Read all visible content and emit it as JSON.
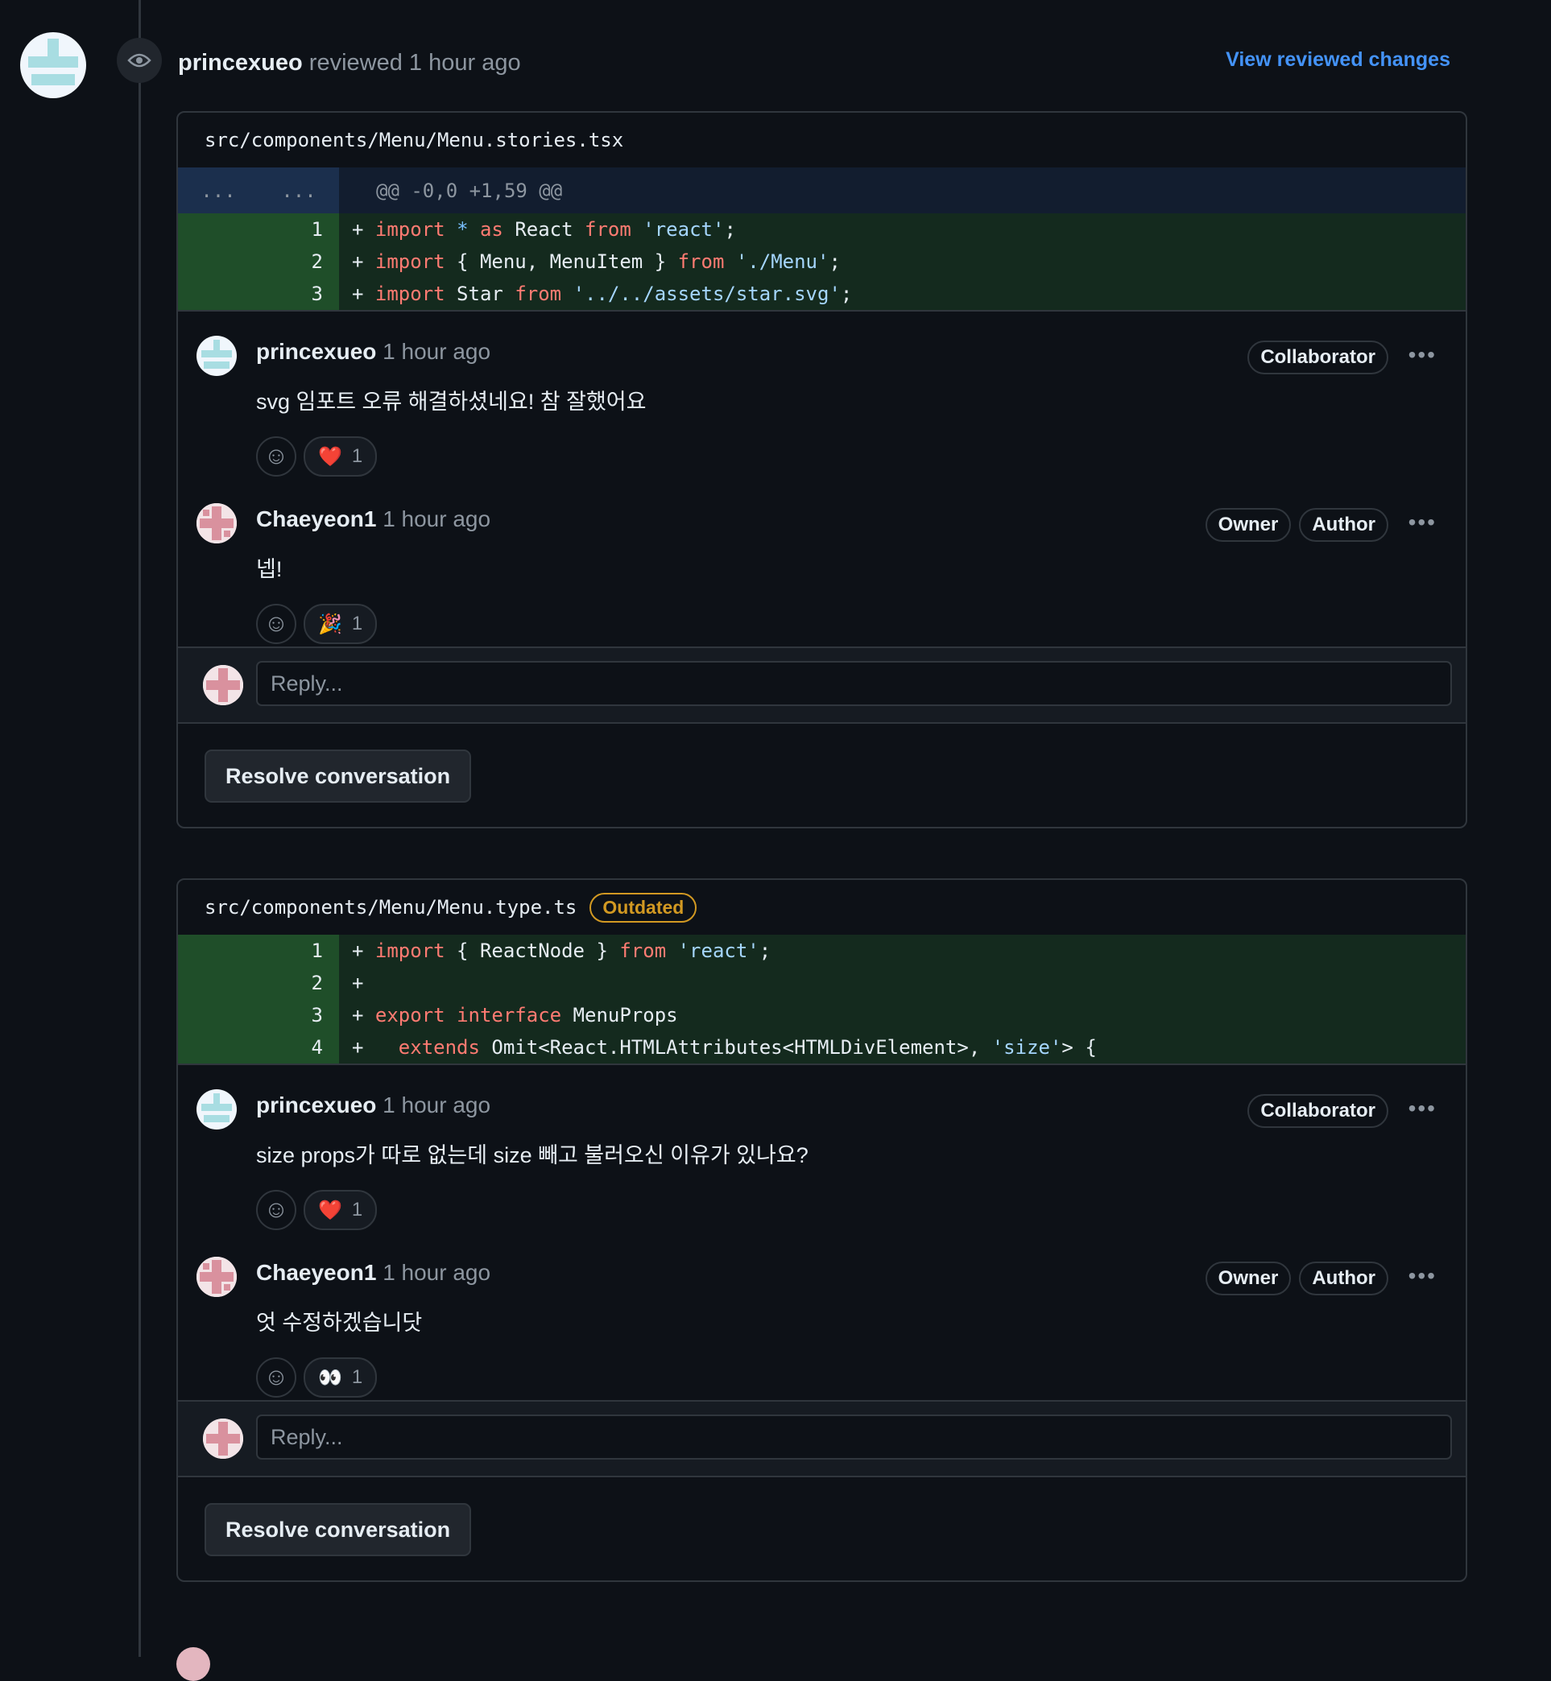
{
  "review": {
    "user": "princexueo",
    "action": "reviewed",
    "time": "1 hour ago",
    "view_link": "View reviewed changes"
  },
  "colors": {
    "accent": "#4493f8",
    "outdated": "#d29922",
    "added_bg": "#142a1e"
  },
  "threads": [
    {
      "file": "src/components/Menu/Menu.stories.tsx",
      "hunk": {
        "left": "...",
        "right": "...",
        "text": "@@ -0,0 +1,59 @@"
      },
      "lines": [
        {
          "num": "1",
          "code": "+ import * as React from 'react';"
        },
        {
          "num": "2",
          "code": "+ import { Menu, MenuItem } from './Menu';"
        },
        {
          "num": "3",
          "code": "+ import Star from '../../assets/star.svg';"
        }
      ],
      "comments": [
        {
          "user": "princexueo",
          "time": "1 hour ago",
          "badges": [
            "Collaborator"
          ],
          "body": "svg 임포트 오류 해결하셨네요! 참 잘했어요",
          "reaction": {
            "emoji": "❤️",
            "count": "1"
          }
        },
        {
          "user": "Chaeyeon1",
          "time": "1 hour ago",
          "badges": [
            "Owner",
            "Author"
          ],
          "body": "넵!",
          "reaction": {
            "emoji": "🎉",
            "count": "1"
          }
        }
      ],
      "reply_placeholder": "Reply...",
      "resolve": "Resolve conversation"
    },
    {
      "file": "src/components/Menu/Menu.type.ts",
      "outdated": "Outdated",
      "lines": [
        {
          "num": "1",
          "code": "+ import { ReactNode } from 'react';"
        },
        {
          "num": "2",
          "code": "+"
        },
        {
          "num": "3",
          "code": "+ export interface MenuProps"
        },
        {
          "num": "4",
          "code": "+   extends Omit<React.HTMLAttributes<HTMLDivElement>, 'size'> {"
        }
      ],
      "comments": [
        {
          "user": "princexueo",
          "time": "1 hour ago",
          "badges": [
            "Collaborator"
          ],
          "body": "size props가 따로 없는데 size 빼고 불러오신 이유가 있나요?",
          "reaction": {
            "emoji": "❤️",
            "count": "1"
          }
        },
        {
          "user": "Chaeyeon1",
          "time": "1 hour ago",
          "badges": [
            "Owner",
            "Author"
          ],
          "body": "엇 수정하겠습니닷",
          "reaction": {
            "emoji": "👀",
            "count": "1"
          }
        }
      ],
      "reply_placeholder": "Reply...",
      "resolve": "Resolve conversation"
    }
  ],
  "icons": {
    "eye": "eye-icon",
    "smiley": "smiley-icon",
    "kebab": "kebab-horizontal-icon"
  }
}
